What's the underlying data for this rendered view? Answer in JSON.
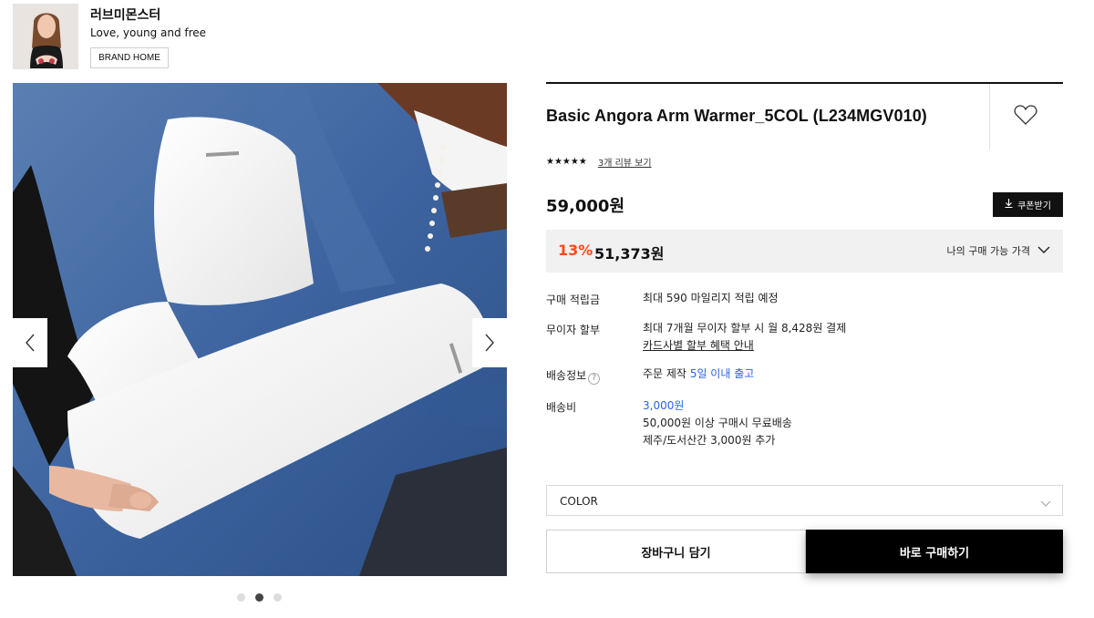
{
  "brand": {
    "name": "러브미몬스터",
    "slogan": "Love, young and free",
    "home_button": "BRAND HOME"
  },
  "gallery": {
    "prev_icon": "chevron-left-icon",
    "next_icon": "chevron-right-icon",
    "current_slide": 2,
    "total_slides": 3
  },
  "product": {
    "title": "Basic Angora Arm Warmer_5COL (L234MGV010)",
    "stars": "★★★★★",
    "rating": 5,
    "review_link": "3개 리뷰 보기",
    "price": "59,000원",
    "coupon_button": "쿠폰받기",
    "sale_rate": "13%",
    "sale_price": "51,373원",
    "my_price_label": "나의 구매 가능 가격"
  },
  "info": {
    "points_label": "구매 적립금",
    "points_value": "최대 590 마일리지 적립 예정",
    "installment_label": "무이자 할부",
    "installment_value": "최대 7개월 무이자 할부 시 월 8,428원 결제",
    "installment_link": "카드사별 할부 혜택 안내",
    "shipping_label": "배송정보",
    "shipping_help": "?",
    "shipping_prefix": "주문 제작",
    "shipping_highlight": "5일 이내 출고",
    "fee_label": "배송비",
    "fee_value": "3,000원",
    "fee_free": "50,000원 이상 구매시 무료배송",
    "fee_extra": "제주/도서산간 3,000원 추가"
  },
  "options": {
    "color_label": "COLOR"
  },
  "actions": {
    "cart": "장바구니 담기",
    "buy": "바로 구매하기"
  },
  "colors": {
    "sale_accent": "#ff4a17",
    "link_blue": "#2c64e3",
    "button_black": "#000000",
    "sale_box_bg": "#f1f1f1"
  }
}
